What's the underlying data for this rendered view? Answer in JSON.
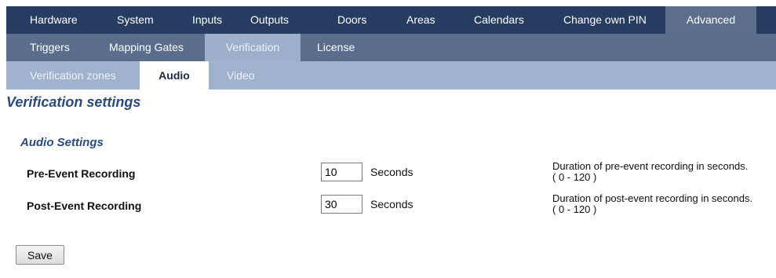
{
  "nav_primary": [
    {
      "label": "Hardware"
    },
    {
      "label": "System"
    },
    {
      "label": "Inputs"
    },
    {
      "label": "Outputs"
    },
    {
      "label": "Doors"
    },
    {
      "label": "Areas"
    },
    {
      "label": "Calendars"
    },
    {
      "label": "Change own PIN"
    },
    {
      "label": "Advanced",
      "active": true
    }
  ],
  "nav_secondary": [
    {
      "label": "Triggers"
    },
    {
      "label": "Mapping Gates"
    },
    {
      "label": "Verification",
      "active": true
    },
    {
      "label": "License"
    }
  ],
  "nav_tertiary": [
    {
      "label": "Verification zones"
    },
    {
      "label": "Audio",
      "active": true
    },
    {
      "label": "Video"
    }
  ],
  "page_title": "Verification settings",
  "section_title": "Audio Settings",
  "settings": [
    {
      "label": "Pre-Event Recording",
      "value": "10",
      "unit": "Seconds",
      "description_line1": "Duration of pre-event recording in seconds.",
      "description_line2": "( 0 - 120 )"
    },
    {
      "label": "Post-Event Recording",
      "value": "30",
      "unit": "Seconds",
      "description_line1": "Duration of post-event recording in seconds.",
      "description_line2": "( 0 - 120 )"
    }
  ],
  "save_label": "Save",
  "colors": {
    "nav_primary_bg": "#263c60",
    "nav_secondary_bg": "#5a6d8d",
    "nav_tertiary_bg": "#a0b2cd",
    "heading": "#2b4a7a"
  }
}
